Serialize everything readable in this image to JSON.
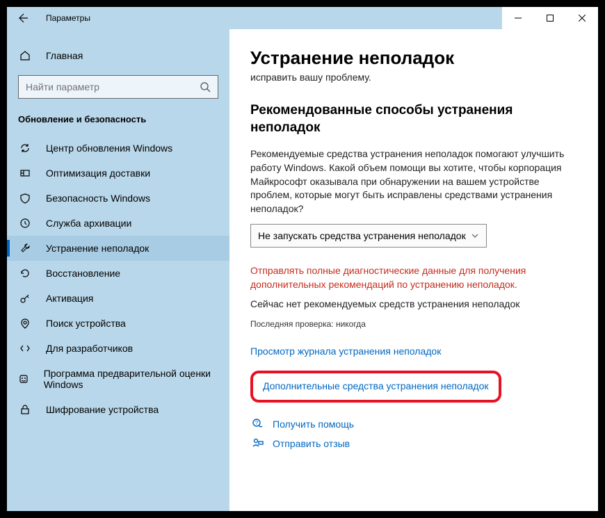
{
  "window": {
    "title": "Параметры"
  },
  "sidebar": {
    "home": "Главная",
    "search_placeholder": "Найти параметр",
    "section": "Обновление и безопасность",
    "items": [
      {
        "label": "Центр обновления Windows"
      },
      {
        "label": "Оптимизация доставки"
      },
      {
        "label": "Безопасность Windows"
      },
      {
        "label": "Служба архивации"
      },
      {
        "label": "Устранение неполадок"
      },
      {
        "label": "Восстановление"
      },
      {
        "label": "Активация"
      },
      {
        "label": "Поиск устройства"
      },
      {
        "label": "Для разработчиков"
      },
      {
        "label": "Программа предварительной оценки Windows"
      },
      {
        "label": "Шифрование устройства"
      }
    ]
  },
  "main": {
    "heading": "Устранение неполадок",
    "subtitle": "исправить вашу проблему.",
    "section_title": "Рекомендованные способы устранения неполадок",
    "description": "Рекомендуемые средства устранения неполадок помогают улучшить работу Windows. Какой объем помощи вы хотите, чтобы корпорация Майкрософт оказывала при обнаружении на вашем устройстве проблем, которые могут быть исправлены средствами устранения неполадок?",
    "dropdown_value": "Не запускать средства устранения неполадок",
    "red_notice": "Отправлять полные диагностические данные для получения дополнительных рекомендаций по устранению неполадок.",
    "status": "Сейчас нет рекомендуемых средств устранения неполадок",
    "last_check": "Последняя проверка: никогда",
    "history_link": "Просмотр журнала устранения неполадок",
    "additional_link": "Дополнительные средства устранения неполадок",
    "help_link": "Получить помощь",
    "feedback_link": "Отправить отзыв"
  }
}
